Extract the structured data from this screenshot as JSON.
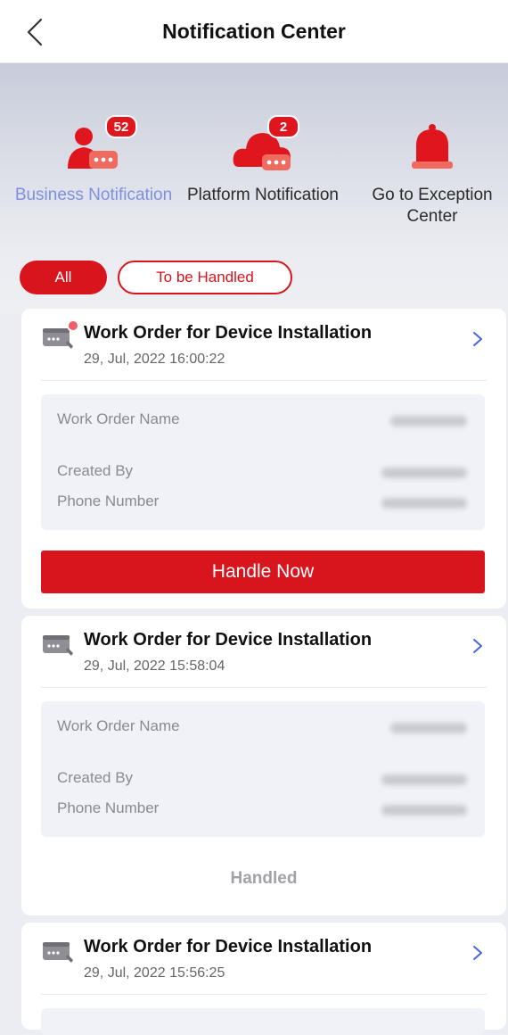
{
  "header": {
    "title": "Notification Center"
  },
  "categories": [
    {
      "label": "Business Notification",
      "badge": "52",
      "active": true
    },
    {
      "label": "Platform Notification",
      "badge": "2",
      "active": false
    },
    {
      "label": "Go to Exception Center",
      "badge": "",
      "active": false
    }
  ],
  "filters": {
    "all": "All",
    "to_be_handled": "To be Handled"
  },
  "cards": [
    {
      "title": "Work Order for Device Installation",
      "time": "29, Jul, 2022 16:00:22",
      "labels": {
        "name": "Work Order Name",
        "created_by": "Created By",
        "phone": "Phone Number"
      },
      "action": "Handle Now",
      "unread": true
    },
    {
      "title": "Work Order for Device Installation",
      "time": "29, Jul, 2022 15:58:04",
      "labels": {
        "name": "Work Order Name",
        "created_by": "Created By",
        "phone": "Phone Number"
      },
      "status": "Handled",
      "unread": false
    },
    {
      "title": "Work Order for Device Installation",
      "time": "29, Jul, 2022 15:56:25"
    }
  ],
  "colors": {
    "accent": "#d8141d",
    "active_tab": "#7e8fe0",
    "chevron": "#4a64d8"
  },
  "icons": [
    "back-chevron-icon",
    "person-chat-icon",
    "cloud-chat-icon",
    "bell-icon",
    "device-icon",
    "chevron-right-icon"
  ]
}
